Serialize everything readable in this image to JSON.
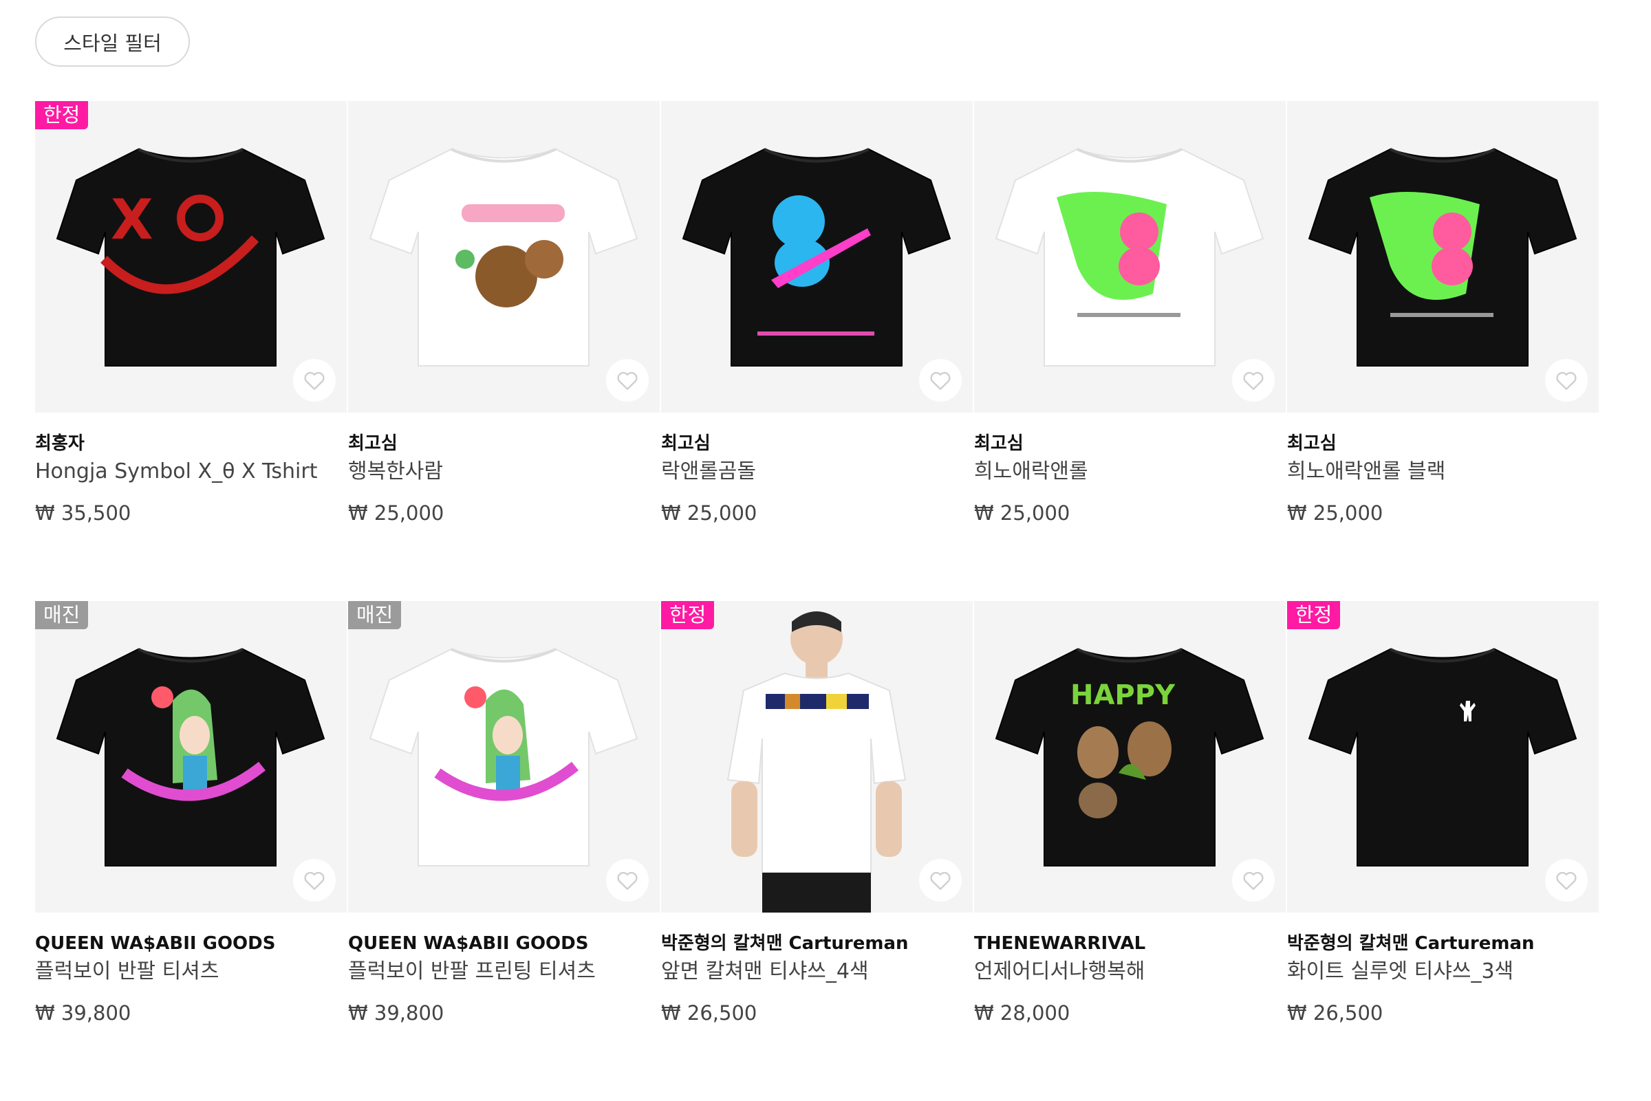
{
  "filter": {
    "label": "스타일 필터"
  },
  "colors": {
    "badge_limited": "#ff1aa3",
    "badge_soldout": "#9b9b9b",
    "thumb_bg": "#f4f4f4"
  },
  "products": [
    {
      "seller": "최홍자",
      "title": "Hongja Symbol X_θ X Tshirt",
      "price": "₩ 35,500",
      "badge": "한정",
      "badge_type": "limited",
      "shirt": "black",
      "design": "red-smiley"
    },
    {
      "seller": "최고심",
      "title": "행복한사람",
      "price": "₩ 25,000",
      "badge": "",
      "badge_type": "",
      "shirt": "white",
      "design": "bear-text"
    },
    {
      "seller": "최고심",
      "title": "락앤롤곰돌",
      "price": "₩ 25,000",
      "badge": "",
      "badge_type": "",
      "shirt": "black",
      "design": "blue-bear-guitar"
    },
    {
      "seller": "최고심",
      "title": "희노애락앤롤",
      "price": "₩ 25,000",
      "badge": "",
      "badge_type": "",
      "shirt": "white",
      "design": "pink-bunny-green"
    },
    {
      "seller": "최고심",
      "title": "희노애락앤롤 블랙",
      "price": "₩ 25,000",
      "badge": "",
      "badge_type": "",
      "shirt": "black",
      "design": "pink-bunny-green"
    },
    {
      "seller": "QUEEN WA$ABII GOODS",
      "title": "플럭보이 반팔 티셔츠",
      "price": "₩ 39,800",
      "badge": "매진",
      "badge_type": "soldout",
      "shirt": "black",
      "design": "anime-unplugged"
    },
    {
      "seller": "QUEEN WA$ABII GOODS",
      "title": "플럭보이 반팔 프린팅 티셔츠",
      "price": "₩ 39,800",
      "badge": "매진",
      "badge_type": "soldout",
      "shirt": "white",
      "design": "anime-unplugged"
    },
    {
      "seller": "박준형의 칼쳐맨 Cartureman",
      "title": "앞면 칼쳐맨 티샤쓰_4색",
      "price": "₩ 26,500",
      "badge": "한정",
      "badge_type": "limited",
      "shirt": "model-white",
      "design": "banner"
    },
    {
      "seller": "THENEWARRIVAL",
      "title": "언제어디서나행복해",
      "price": "₩ 28,000",
      "badge": "",
      "badge_type": "",
      "shirt": "black",
      "design": "happy-quokka"
    },
    {
      "seller": "박준형의 칼쳐맨 Cartureman",
      "title": "화이트 실루엣 티샤쓰_3색",
      "price": "₩ 26,500",
      "badge": "한정",
      "badge_type": "limited",
      "shirt": "black",
      "design": "small-silhouette"
    }
  ]
}
